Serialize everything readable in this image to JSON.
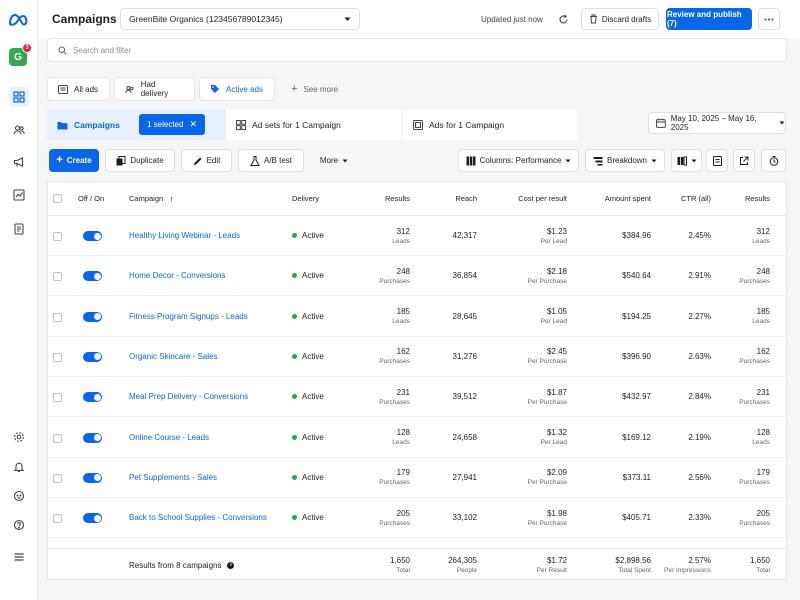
{
  "header": {
    "title": "Campaigns",
    "account": "GreenBite Organics (123456789012345)",
    "updated": "Updated just now",
    "discard_label": "Discard drafts",
    "publish_label": "Review and publish (7)"
  },
  "rail": {
    "account_initial": "G",
    "notification_count": "3"
  },
  "search": {
    "placeholder": "Search and filter"
  },
  "filters": {
    "all_ads": "All ads",
    "had_delivery": "Had delivery",
    "active_ads": "Active ads",
    "see_more": "See more"
  },
  "levels": {
    "campaigns": "Campaigns",
    "selected": "1 selected",
    "adsets": "Ad sets for 1 Campaign",
    "ads": "Ads for 1 Campaign"
  },
  "date_range": "May 10, 2025 – May 16, 2025",
  "toolbar": {
    "create": "Create",
    "duplicate": "Duplicate",
    "edit": "Edit",
    "ab_test": "A/B test",
    "more": "More",
    "columns": "Columns: Performance",
    "breakdown": "Breakdown"
  },
  "columns": {
    "onoff": "Off / On",
    "campaign": "Campaign",
    "delivery": "Delivery",
    "results": "Results",
    "reach": "Reach",
    "cost": "Cost per result",
    "spent": "Amount spent",
    "ctr": "CTR (all)",
    "results2": "Results"
  },
  "rows": [
    {
      "name": "Healthy Living Webinar - Leads",
      "delivery": "Active",
      "results": "312",
      "result_type": "Leads",
      "reach": "42,317",
      "cost": "$1.23",
      "cost_unit": "Per Lead",
      "spent": "$384.96",
      "ctr": "2.45%"
    },
    {
      "name": "Home Decor - Conversions",
      "delivery": "Active",
      "results": "248",
      "result_type": "Purchases",
      "reach": "36,854",
      "cost": "$2.18",
      "cost_unit": "Per Purchase",
      "spent": "$540.64",
      "ctr": "2.91%"
    },
    {
      "name": "Fitness Program Signups - Leads",
      "delivery": "Active",
      "results": "185",
      "result_type": "Leads",
      "reach": "28,645",
      "cost": "$1.05",
      "cost_unit": "Per Lead",
      "spent": "$194.25",
      "ctr": "2.27%"
    },
    {
      "name": "Organic Skincare - Sales",
      "delivery": "Active",
      "results": "162",
      "result_type": "Purchases",
      "reach": "31,276",
      "cost": "$2.45",
      "cost_unit": "Per Purchase",
      "spent": "$396.90",
      "ctr": "2.63%"
    },
    {
      "name": "Meal Prep Delivery - Conversions",
      "delivery": "Active",
      "results": "231",
      "result_type": "Purchases",
      "reach": "39,512",
      "cost": "$1.87",
      "cost_unit": "Per Purchase",
      "spent": "$432.97",
      "ctr": "2.84%"
    },
    {
      "name": "Online Course - Leads",
      "delivery": "Active",
      "results": "128",
      "result_type": "Leads",
      "reach": "24,658",
      "cost": "$1.32",
      "cost_unit": "Per Lead",
      "spent": "$169.12",
      "ctr": "2.19%"
    },
    {
      "name": "Pet Supplements - Sales",
      "delivery": "Active",
      "results": "179",
      "result_type": "Purchases",
      "reach": "27,941",
      "cost": "$2.09",
      "cost_unit": "Per Purchase",
      "spent": "$373.11",
      "ctr": "2.56%"
    },
    {
      "name": "Back to School Supplies - Conversions",
      "delivery": "Active",
      "results": "205",
      "result_type": "Purchases",
      "reach": "33,102",
      "cost": "$1.98",
      "cost_unit": "Per Purchase",
      "spent": "$405.71",
      "ctr": "2.33%"
    }
  ],
  "footer": {
    "label": "Results from 8 campaigns",
    "results": "1,650",
    "results_sub": "Total",
    "reach": "264,305",
    "reach_sub": "People",
    "cost": "$1.72",
    "cost_sub": "Per Result",
    "spent": "$2,898.56",
    "spent_sub": "Total Spent",
    "ctr": "2.57%",
    "ctr_sub": "Per Impressions",
    "results2": "1,650",
    "results2_sub": "Total"
  },
  "colors": {
    "accent": "#0a66e8",
    "active_dot": "#31a24c",
    "account_badge": "#36a852",
    "badge_red": "#e41e3f"
  }
}
